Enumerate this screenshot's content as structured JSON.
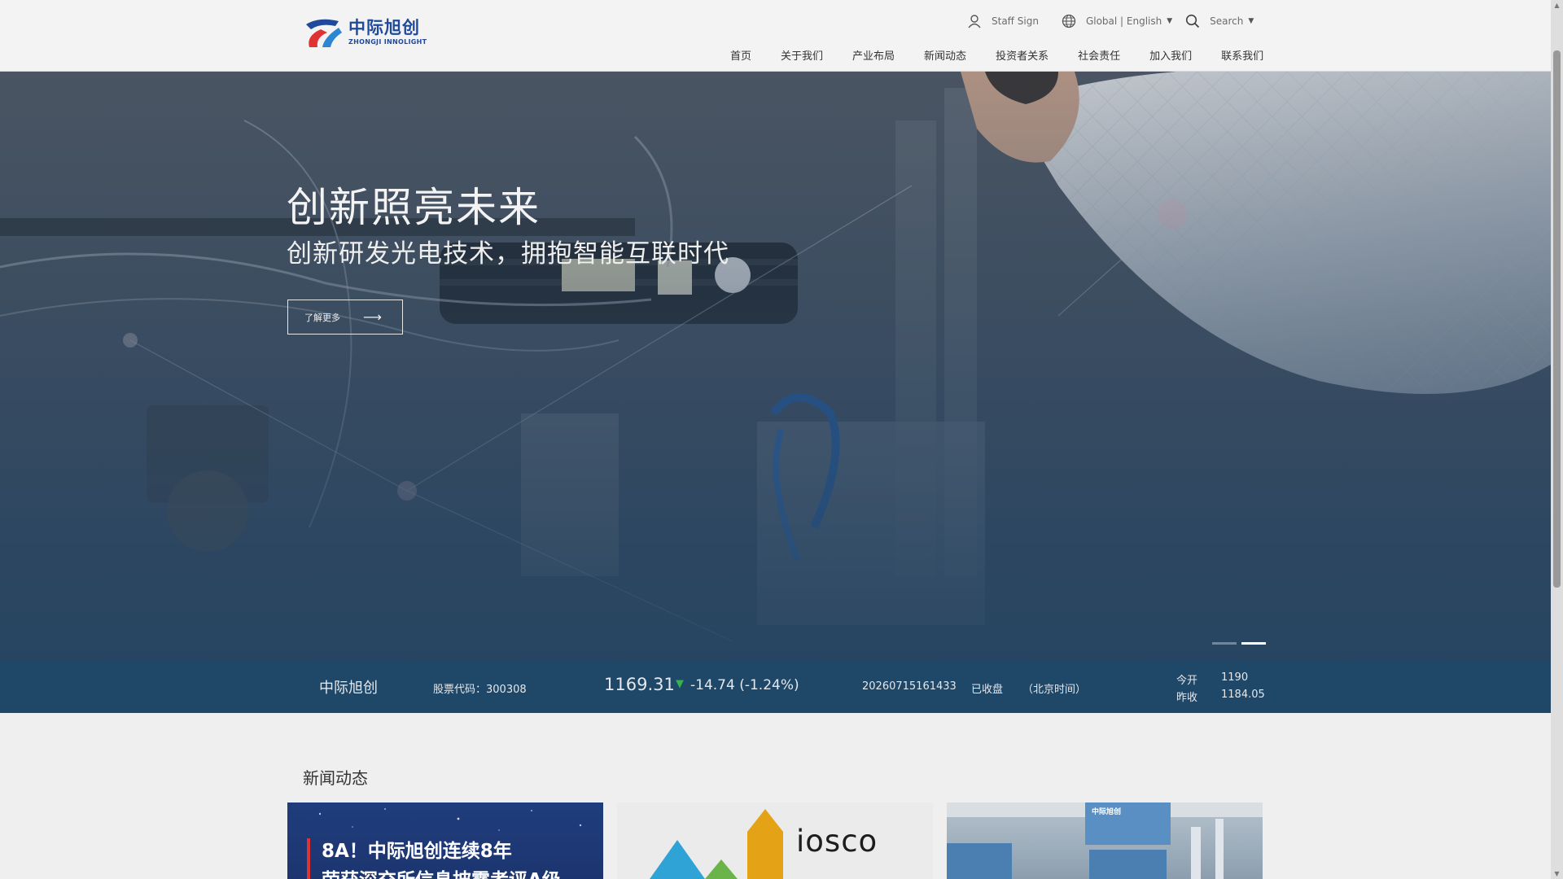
{
  "header": {
    "logo": {
      "cn": "中际旭创",
      "en": "ZHONGJI INNOLIGHT"
    },
    "staff_sign": "Staff Sign",
    "global": "Global | English",
    "search": "Search",
    "nav": [
      "首页",
      "关于我们",
      "产业布局",
      "新闻动态",
      "投资者关系",
      "社会责任",
      "加入我们",
      "联系我们"
    ]
  },
  "hero": {
    "title": "创新照亮未来",
    "subtitle": "创新研发光电技术，拥抱智能互联时代",
    "button": "了解更多",
    "slides_total": 2,
    "active_slide": 2
  },
  "stock": {
    "company": "中际旭创",
    "code_label": "股票代码：",
    "code": "300308",
    "price": "1169.31",
    "change": "-14.74 (-1.24%)",
    "timestamp": "20260715161433",
    "status": "已收盘",
    "timezone": "（北京时间）",
    "open_label": "今开",
    "open_value": "1190",
    "prev_close_label": "昨收",
    "prev_close_value": "1184.05"
  },
  "news": {
    "title": "新闻动态",
    "cards": [
      {
        "headline": "8A！中际旭创连续8年",
        "headline2": "荣获深交所信息披露考评A级"
      },
      {
        "logo_text": "iosco"
      },
      {
        "caption": "中际旭创"
      }
    ]
  },
  "colors": {
    "brand_blue": "#1f4a9c",
    "brand_red": "#e03232",
    "stock_bar": "#1f4767",
    "down_green": "#37b24d"
  },
  "icons": [
    "user-icon",
    "globe-icon",
    "search-icon",
    "arrow-right-icon",
    "down-arrow-icon"
  ]
}
